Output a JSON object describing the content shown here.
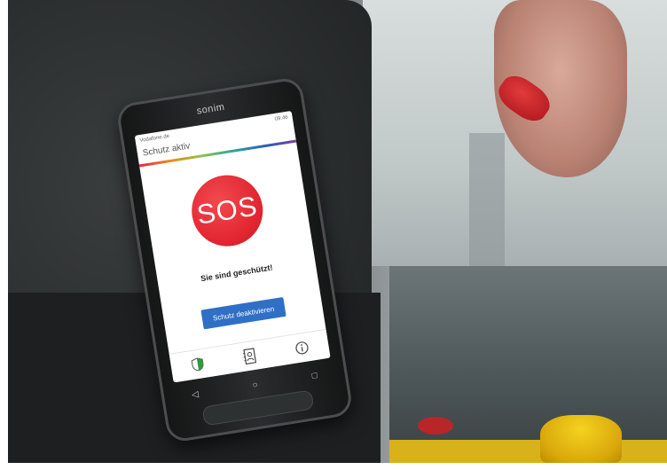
{
  "device": {
    "brand": "sonim"
  },
  "status_bar": {
    "carrier": "Vodafone.de",
    "time": "09:46"
  },
  "app": {
    "title": "Schutz aktiv",
    "sos_label": "SOS",
    "status_message": "Sie sind geschützt!",
    "deactivate_label": "Schutz deaktivieren",
    "colors": {
      "sos": "#e0232f",
      "button": "#2f6fc6",
      "shield": "#2e9a3a"
    }
  },
  "tabs": [
    {
      "icon": "shield-icon"
    },
    {
      "icon": "contacts-icon"
    },
    {
      "icon": "info-icon"
    }
  ],
  "nav_buttons": [
    {
      "icon": "back-icon",
      "glyph": "◁"
    },
    {
      "icon": "home-icon",
      "glyph": "○"
    },
    {
      "icon": "recents-icon",
      "glyph": "□"
    }
  ]
}
